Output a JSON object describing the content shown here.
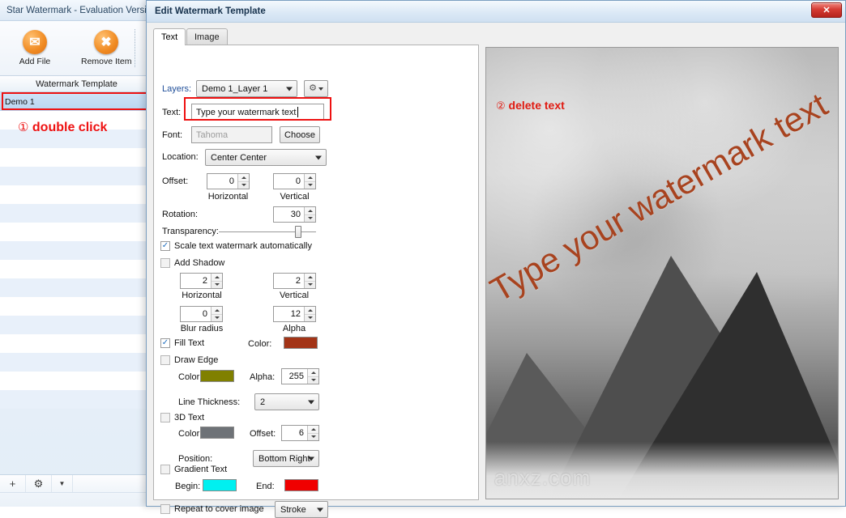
{
  "main_window": {
    "title": "Star Watermark - Evaluation Versi",
    "toolbar": [
      {
        "label": "Add File",
        "icon": "add-file-icon"
      },
      {
        "label": "Remove Item",
        "icon": "remove-item-icon"
      }
    ],
    "template_header": "Watermark Template",
    "rows": [
      {
        "label": "Demo 1",
        "selected": true
      }
    ],
    "footer": {
      "add_icon": "plus-icon",
      "settings_icon": "gear-icon",
      "dropdown_icon": "chevron-down-icon"
    }
  },
  "annotations": {
    "one": {
      "marker": "①",
      "text": "double click"
    },
    "two": {
      "marker": "②",
      "text": "delete text"
    }
  },
  "dialog": {
    "title": "Edit Watermark Template",
    "close_label": "✕",
    "tabs": [
      {
        "label": "Text",
        "active": true
      },
      {
        "label": "Image",
        "active": false
      }
    ],
    "form": {
      "layers_label": "Layers:",
      "layers_value": "Demo 1_Layer 1",
      "layers_settings_icon": "gear-dropdown-icon",
      "text_label": "Text:",
      "text_value": "Type your watermark text",
      "font_label": "Font:",
      "font_placeholder": "Tahoma",
      "font_choose_button": "Choose",
      "location_label": "Location:",
      "location_value": "Center Center",
      "offset_label": "Offset:",
      "offset_horizontal_value": "0",
      "offset_horizontal_caption": "Horizontal",
      "offset_vertical_value": "0",
      "offset_vertical_caption": "Vertical",
      "rotation_label": "Rotation:",
      "rotation_value": "30",
      "transparency_label": "Transparency:",
      "transparency_percent": 80,
      "scale_auto_label": "Scale text watermark automatically",
      "scale_auto_checked": true,
      "add_shadow_label": "Add Shadow",
      "add_shadow_checked": false,
      "shadow_horizontal_value": "2",
      "shadow_horizontal_caption": "Horizontal",
      "shadow_vertical_value": "2",
      "shadow_vertical_caption": "Vertical",
      "shadow_blur_value": "0",
      "shadow_blur_caption": "Blur radius",
      "shadow_alpha_value": "12",
      "shadow_alpha_caption": "Alpha",
      "fill_text_label": "Fill Text",
      "fill_text_checked": true,
      "fill_color_label": "Color:",
      "fill_color": "#a33417",
      "draw_edge_label": "Draw Edge",
      "draw_edge_checked": false,
      "edge_color_label": "Color:",
      "edge_color": "#808000",
      "edge_alpha_label": "Alpha:",
      "edge_alpha_value": "255",
      "line_thickness_label": "Line Thickness:",
      "line_thickness_value": "2",
      "three_d_label": "3D Text",
      "three_d_checked": false,
      "three_d_color_label": "Color:",
      "three_d_color": "#6e7277",
      "three_d_offset_label": "Offset:",
      "three_d_offset_value": "6",
      "position_label": "Position:",
      "position_value": "Bottom Right",
      "gradient_label": "Gradient Text",
      "gradient_checked": false,
      "gradient_begin_label": "Begin:",
      "gradient_begin_color": "#00f0f0",
      "gradient_end_label": "End:",
      "gradient_end_color": "#f00000",
      "repeat_label": "Repeat to cover image",
      "repeat_checked": false,
      "repeat_mode_value": "Stroke"
    },
    "preview": {
      "watermark_text": "Type your watermark text",
      "watermark_color": "#a8431f",
      "site_watermark": "anxz.com"
    }
  }
}
